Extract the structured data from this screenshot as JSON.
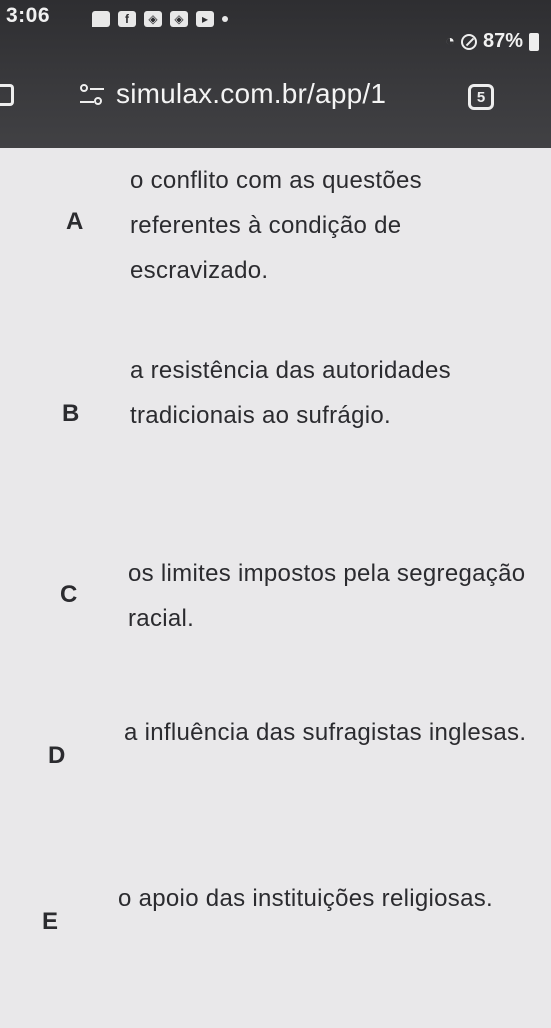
{
  "status_bar": {
    "time": "3:06",
    "battery": "87%",
    "notifications": [
      "chat-icon",
      "facebook-icon",
      "app-icon",
      "app-icon",
      "youtube-icon",
      "dot-icon"
    ]
  },
  "browser": {
    "url": "simulax.com.br/app/1",
    "tab_count": "5"
  },
  "options": [
    {
      "letter": "A",
      "text": "o conflito com as questões referentes à condição de escravizado."
    },
    {
      "letter": "B",
      "text": "a resistência das autoridades tradicionais ao sufrágio."
    },
    {
      "letter": "C",
      "text": "os limites impostos pela segregação racial."
    },
    {
      "letter": "D",
      "text": "a influência das sufragistas inglesas."
    },
    {
      "letter": "E",
      "text": "o apoio das instituições religiosas."
    }
  ]
}
